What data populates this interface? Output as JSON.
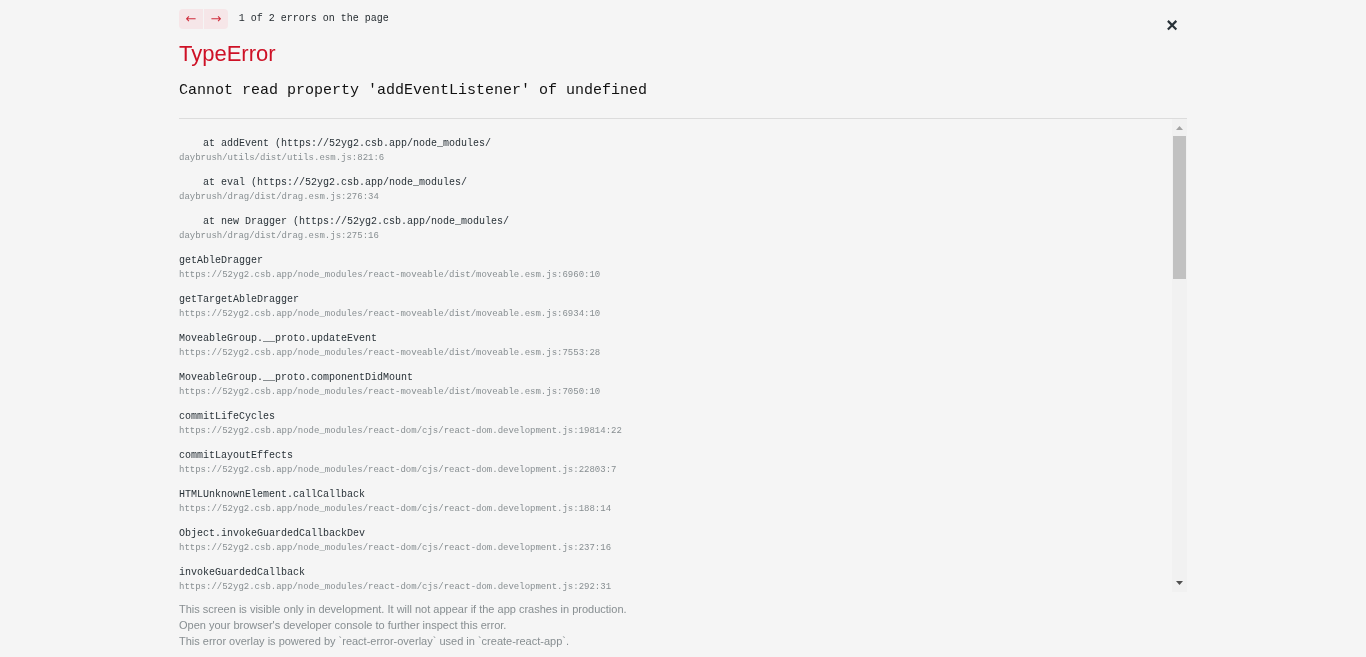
{
  "navigation": {
    "buttons": [
      "←",
      "→"
    ],
    "counter": "1 of 2 errors on the page",
    "close": "×"
  },
  "error": {
    "type": "TypeError",
    "message": "Cannot read property 'addEventListener' of undefined"
  },
  "stack_frames": [
    {
      "function": "    at addEvent (https://52yg2.csb.app/node_modules/",
      "location": "daybrush/utils/dist/utils.esm.js:821:6"
    },
    {
      "function": "    at eval (https://52yg2.csb.app/node_modules/",
      "location": "daybrush/drag/dist/drag.esm.js:276:34"
    },
    {
      "function": "    at new Dragger (https://52yg2.csb.app/node_modules/",
      "location": "daybrush/drag/dist/drag.esm.js:275:16"
    },
    {
      "function": "getAbleDragger",
      "location": "https://52yg2.csb.app/node_modules/react-moveable/dist/moveable.esm.js:6960:10"
    },
    {
      "function": "getTargetAbleDragger",
      "location": "https://52yg2.csb.app/node_modules/react-moveable/dist/moveable.esm.js:6934:10"
    },
    {
      "function": "MoveableGroup.__proto.updateEvent",
      "location": "https://52yg2.csb.app/node_modules/react-moveable/dist/moveable.esm.js:7553:28"
    },
    {
      "function": "MoveableGroup.__proto.componentDidMount",
      "location": "https://52yg2.csb.app/node_modules/react-moveable/dist/moveable.esm.js:7050:10"
    },
    {
      "function": "commitLifeCycles",
      "location": "https://52yg2.csb.app/node_modules/react-dom/cjs/react-dom.development.js:19814:22"
    },
    {
      "function": "commitLayoutEffects",
      "location": "https://52yg2.csb.app/node_modules/react-dom/cjs/react-dom.development.js:22803:7"
    },
    {
      "function": "HTMLUnknownElement.callCallback",
      "location": "https://52yg2.csb.app/node_modules/react-dom/cjs/react-dom.development.js:188:14"
    },
    {
      "function": "Object.invokeGuardedCallbackDev",
      "location": "https://52yg2.csb.app/node_modules/react-dom/cjs/react-dom.development.js:237:16"
    },
    {
      "function": "invokeGuardedCallback",
      "location": "https://52yg2.csb.app/node_modules/react-dom/cjs/react-dom.development.js:292:31"
    }
  ],
  "footer": [
    "This screen is visible only in development. It will not appear if the app crashes in production.",
    "Open your browser's developer console to further inspect this error.",
    "This error overlay is powered by `react-error-overlay` used in `create-react-app`."
  ]
}
